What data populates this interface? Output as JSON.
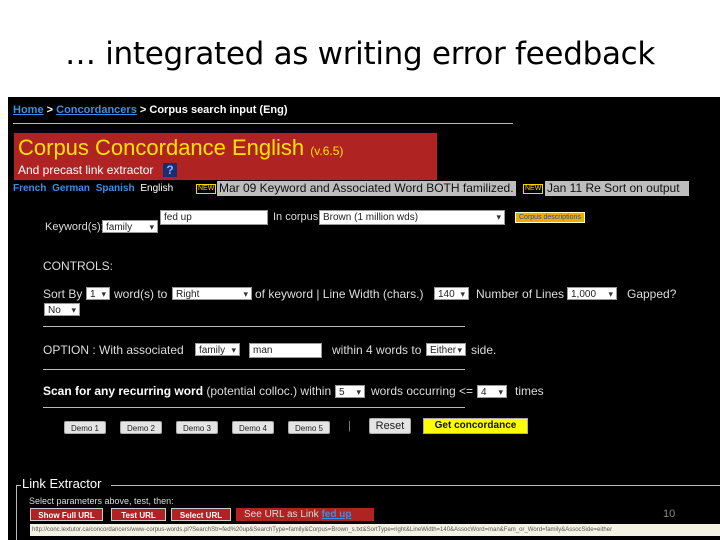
{
  "slide": {
    "title": "… integrated as writing error feedback",
    "page_number": "10"
  },
  "breadcrumb": {
    "home": "Home",
    "concordancers": "Concordancers",
    "current": "Corpus search input (Eng)",
    "sep": ">"
  },
  "banner": {
    "title": "Corpus Concordance English",
    "version": "(v.6.5)",
    "subtitle": "And precast link extractor",
    "help": "?",
    "color": "#b02323"
  },
  "languages": [
    "French",
    "German",
    "Spanish",
    "English"
  ],
  "news": [
    {
      "badge": "NEW",
      "text": "Mar 09   Keyword and Associated Word BOTH familized."
    },
    {
      "badge": "NEW",
      "text": "Jan 11   Re Sort on output"
    }
  ],
  "search": {
    "keyword_label": "Keyword(s):",
    "keyword_type": "family",
    "keyword_value": "fed up",
    "corpus_label": "In corpus:",
    "corpus": "Brown (1 million wds)",
    "corpus_desc": "Corpus descriptions"
  },
  "controls": {
    "heading": "CONTROLS:",
    "sort_by": "Sort By",
    "sort_n": "1",
    "words_to": "word(s) to",
    "direction": "Right",
    "of_keyword": "of keyword  |  Line Width (chars.)",
    "line_width": "140",
    "num_lines_label": "Number of Lines",
    "num_lines": "1,000",
    "gapped_label": "Gapped?",
    "gapped": "No"
  },
  "option": {
    "label": "OPTION :   With associated",
    "assoc_type": "family",
    "assoc_word": "man",
    "within": "within 4 words to",
    "side": "Either",
    "side_suffix": "side."
  },
  "scan": {
    "bold": "Scan for any recurring word",
    "rest": "(potential colloc.) within",
    "within": "5",
    "occurring": "words occurring <=",
    "times_value": "4",
    "times": "times"
  },
  "buttons": {
    "demos": [
      "Demo 1",
      "Demo 2",
      "Demo 3",
      "Demo 4",
      "Demo 5"
    ],
    "sep": "|",
    "reset": "Reset",
    "get": "Get concordance"
  },
  "link_extractor": {
    "legend": "Link Extractor",
    "instructions": "Select parameters above, test, then:",
    "show_full": "Show Full URL",
    "test": "Test URL",
    "select": "Select URL",
    "see_as_link": "See URL as Link",
    "link_text": "fed up",
    "url": "http://conc.lextutor.ca/concordancers/www-corpus-words.pl?SearchStr=fed%20up&SearchType=family&Corpus=Brown_s.txt&SortType=right&LineWidth=140&AssocWord=man&Fam_or_Word=family&AssocSide=either"
  }
}
